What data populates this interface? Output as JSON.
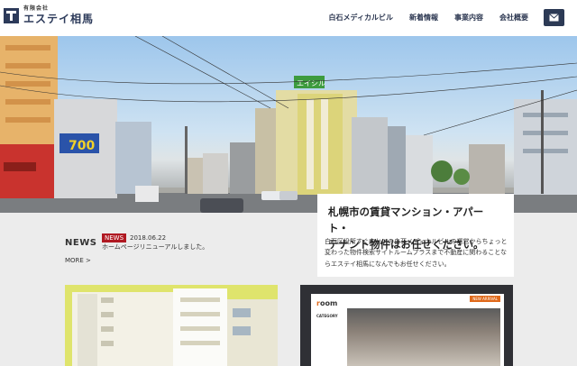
{
  "header": {
    "company_prefix": "有限会社",
    "company_name": "エステイ相馬",
    "nav": [
      "白石メディカルビル",
      "新着情報",
      "事業内容",
      "会社概要"
    ],
    "mail_icon": "mail-icon"
  },
  "hero": {
    "building_sign": "エイシル",
    "price_sign": "700"
  },
  "tagline": {
    "title_line1": "札幌市の賃貸マンション・アパート・",
    "title_line2": "テナント物件はお任せください。",
    "body": "白石区役所すぐ向かいの白石メディカルビルの運営からちょっと変わった物件検索サイトルームプラスまで不動産に関わることならエステイ相馬になんでもお任せください。"
  },
  "news": {
    "heading": "NEWS",
    "badge": "NEWS",
    "date": "2018.06.22",
    "text": "ホームページリニューアルしました。",
    "more": "MORE >"
  },
  "room_card": {
    "logo_prefix": "r",
    "logo_main": "oom",
    "badge": "NEW ARRIVAL",
    "category": "CATEGORY"
  },
  "colors": {
    "navy": "#2c3a55",
    "news_red": "#b01922",
    "card_yellow": "#dfe46c"
  }
}
